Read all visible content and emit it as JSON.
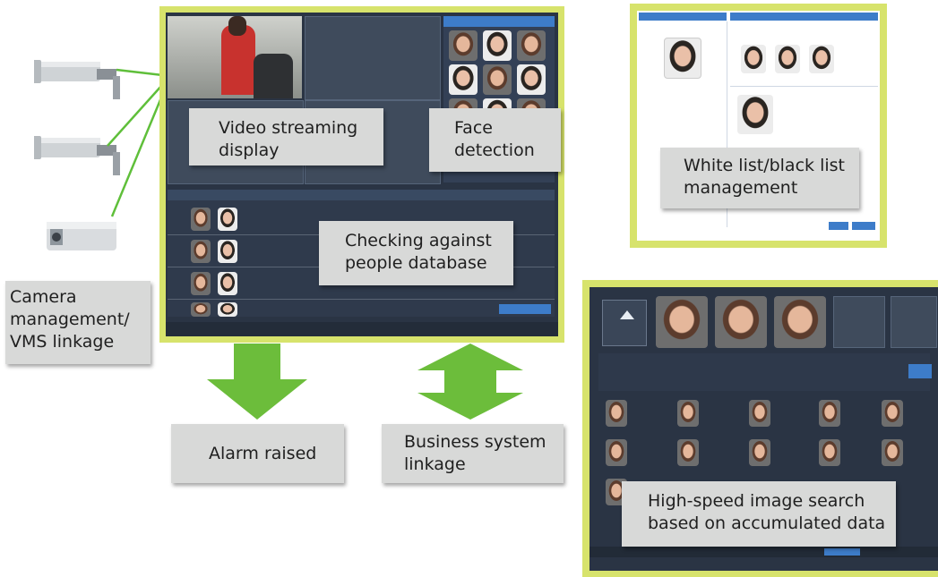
{
  "labels": {
    "video_streaming": "Video streaming display",
    "face_detection": "Face detection",
    "checking": "Checking against people database",
    "white_black_list": "White list/black list management",
    "camera_management": "Camera management/ VMS linkage",
    "alarm_raised": "Alarm raised",
    "business_linkage": "Business system linkage",
    "image_search": "High-speed image search based on accumulated data"
  },
  "icons": [
    "camera-bullet-icon",
    "camera-bullet-icon",
    "camera-box-icon",
    "arrow-down-icon",
    "arrow-updown-icon"
  ],
  "colors": {
    "frame": "#d7e36c",
    "arrow": "#6cbd3b",
    "link_line": "#5fbf3a",
    "label_bg": "#d8d9d8",
    "ui_dark": "#2a3444",
    "ui_blue": "#3d7cc9"
  }
}
